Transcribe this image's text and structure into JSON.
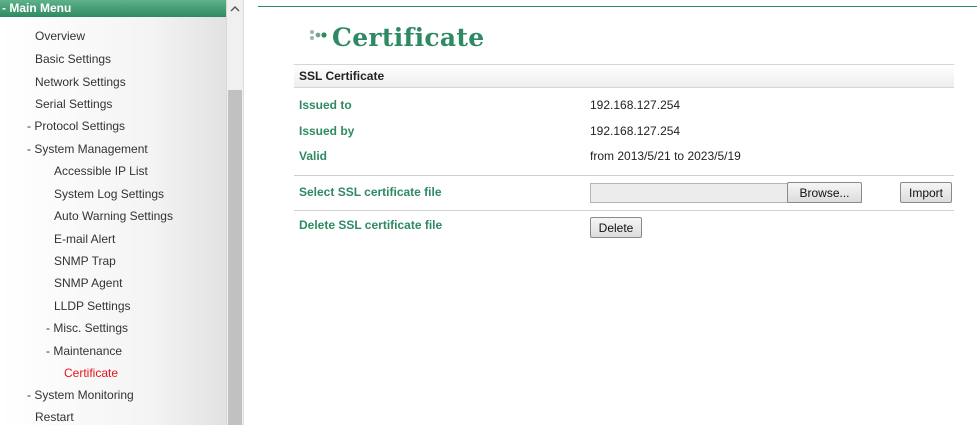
{
  "sidebar": {
    "header": "- Main Menu",
    "items": [
      {
        "label": "Overview"
      },
      {
        "label": "Basic Settings"
      },
      {
        "label": "Network Settings"
      },
      {
        "label": "Serial Settings"
      },
      {
        "label": "- Protocol Settings"
      },
      {
        "label": "- System Management"
      },
      {
        "label": "Accessible IP List"
      },
      {
        "label": "System Log Settings"
      },
      {
        "label": "Auto Warning Settings"
      },
      {
        "label": "E-mail Alert"
      },
      {
        "label": "SNMP Trap"
      },
      {
        "label": "SNMP Agent"
      },
      {
        "label": "LLDP Settings"
      },
      {
        "label": "- Misc. Settings"
      },
      {
        "label": "- Maintenance"
      },
      {
        "label": "Certificate",
        "active": true
      },
      {
        "label": "- System Monitoring"
      },
      {
        "label": "Restart"
      }
    ]
  },
  "page": {
    "title": "Certificate",
    "section_title": "SSL Certificate",
    "issued_to_label": "Issued to",
    "issued_to_value": "192.168.127.254",
    "issued_by_label": "Issued by",
    "issued_by_value": "192.168.127.254",
    "valid_label": "Valid",
    "valid_from_word": "from",
    "valid_from": "2013/5/21",
    "valid_to_word": "to",
    "valid_to": "2023/5/19",
    "select_file_label": "Select SSL certificate file",
    "browse_label": "Browse...",
    "import_label": "Import",
    "delete_file_label": "Delete SSL certificate file",
    "delete_label": "Delete"
  },
  "colors": {
    "accent": "#2e8a62",
    "active_menu": "#e8131b"
  },
  "icons": {
    "title": "dots-icon",
    "scroll_up": "chevron-up-icon"
  }
}
